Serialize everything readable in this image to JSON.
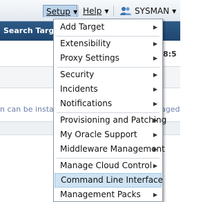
{
  "topbar": {
    "setup_label": "Setup",
    "help_label": "Help",
    "user_label": "SYSMAN"
  },
  "background": {
    "search_label": "Search Targ",
    "time_fragment": "8:5",
    "note_left": "n can be insta",
    "note_right": "aged"
  },
  "setup_menu": {
    "items": [
      {
        "label": "Add Target",
        "submenu": true
      },
      {
        "label": "Extensibility",
        "submenu": true
      },
      {
        "label": "Proxy Settings",
        "submenu": true
      },
      {
        "label": "Security",
        "submenu": true
      },
      {
        "label": "Incidents",
        "submenu": true
      },
      {
        "label": "Notifications",
        "submenu": true
      },
      {
        "label": "Provisioning and Patching",
        "submenu": true
      },
      {
        "label": "My Oracle Support",
        "submenu": true
      },
      {
        "label": "Middleware Management",
        "submenu": true
      },
      {
        "label": "Manage Cloud Control",
        "submenu": true
      },
      {
        "label": "Command Line Interface",
        "submenu": false,
        "highlighted": true
      },
      {
        "label": "Management Packs",
        "submenu": true
      }
    ]
  },
  "icons": {
    "caret": "caret-down-icon",
    "submenu": "chevron-right-icon",
    "user": "user-icon"
  },
  "colors": {
    "header_blue": "#1e4670",
    "highlight": "#cfe3f3",
    "active_top_menu": "#bcd3ea"
  }
}
